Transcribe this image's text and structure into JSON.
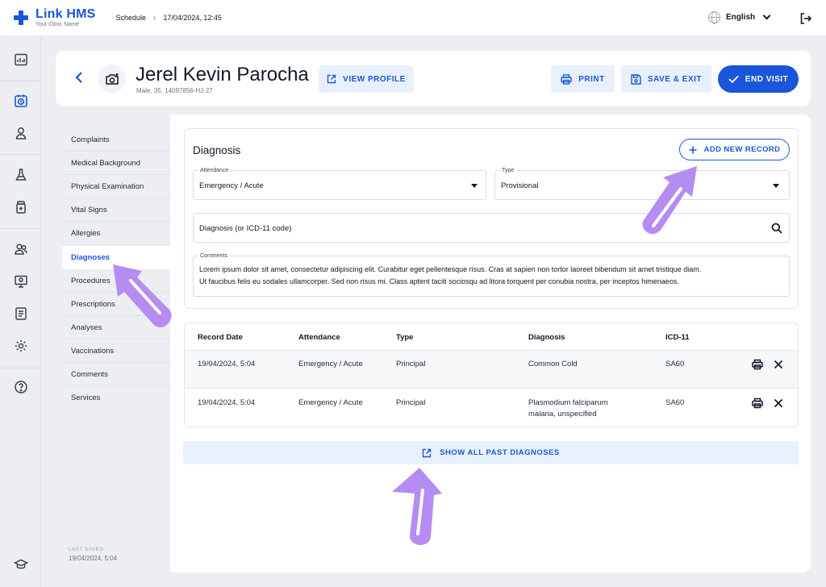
{
  "app": {
    "name": "Link HMS",
    "subtitle": "Your Clinic Name"
  },
  "breadcrumb": {
    "section": "Schedule",
    "separator": "›",
    "current": "17/04/2024, 12:45"
  },
  "language": {
    "label": "English"
  },
  "patient": {
    "name": "Jerel Kevin Parocha",
    "meta": "Male, 35, 14097856-HJ-27"
  },
  "header_buttons": {
    "view_profile": "VIEW PROFILE",
    "print": "PRINT",
    "save_exit": "SAVE & EXIT",
    "end_visit": "END VISIT"
  },
  "sidebar": {
    "items": [
      "Complaints",
      "Medical Background",
      "Physical Examination",
      "Vital Signs",
      "Allergies",
      "Diagnoses",
      "Procedures",
      "Prescriptions",
      "Analyses",
      "Vaccinations",
      "Comments",
      "Services"
    ],
    "active": "Diagnoses",
    "last_saved_label": "LAST SAVED",
    "last_saved_value": "19/04/2024, 5:04"
  },
  "diagnosis_form": {
    "title": "Diagnosis",
    "add_button": "ADD NEW RECORD",
    "attendance_label": "Attendance",
    "attendance_value": "Emergency / Acute",
    "type_label": "Type",
    "type_value": "Provisional",
    "search_placeholder": "Diagnosis (or ICD-11 code)",
    "comments_label": "Comments",
    "comments_line1": "Lorem ipsum dolor sit amet, consectetur adipiscing elit. Curabitur eget pellentesque risus. Cras at sapien non tortor laoreet bibendum sit amet tristique diam.",
    "comments_line2": "Ut faucibus felis eu sodales ullamcorper. Sed non risus mi. Class aptent taciti sociosqu ad litora torquent per conubia nostra, per inceptos himenaeos."
  },
  "records_table": {
    "headers": [
      "Record Date",
      "Attendance",
      "Type",
      "Diagnosis",
      "ICD-11"
    ],
    "rows": [
      {
        "date": "19/04/2024, 5:04",
        "attendance": "Emergency / Acute",
        "type": "Principal",
        "diagnosis_line1": "Common Cold",
        "diagnosis_line2": "",
        "icd": "SA60"
      },
      {
        "date": "19/04/2024, 5:04",
        "attendance": "Emergency / Acute",
        "type": "Principal",
        "diagnosis_line1": "Plasmodium falciparum",
        "diagnosis_line2": "malaria, unspecified",
        "icd": "SA60"
      }
    ]
  },
  "show_all": "SHOW ALL PAST DIAGNOSES",
  "colors": {
    "primary": "#1a56db",
    "light_button": "#e8f1fb",
    "annotation_arrow": "#b48cf2"
  }
}
